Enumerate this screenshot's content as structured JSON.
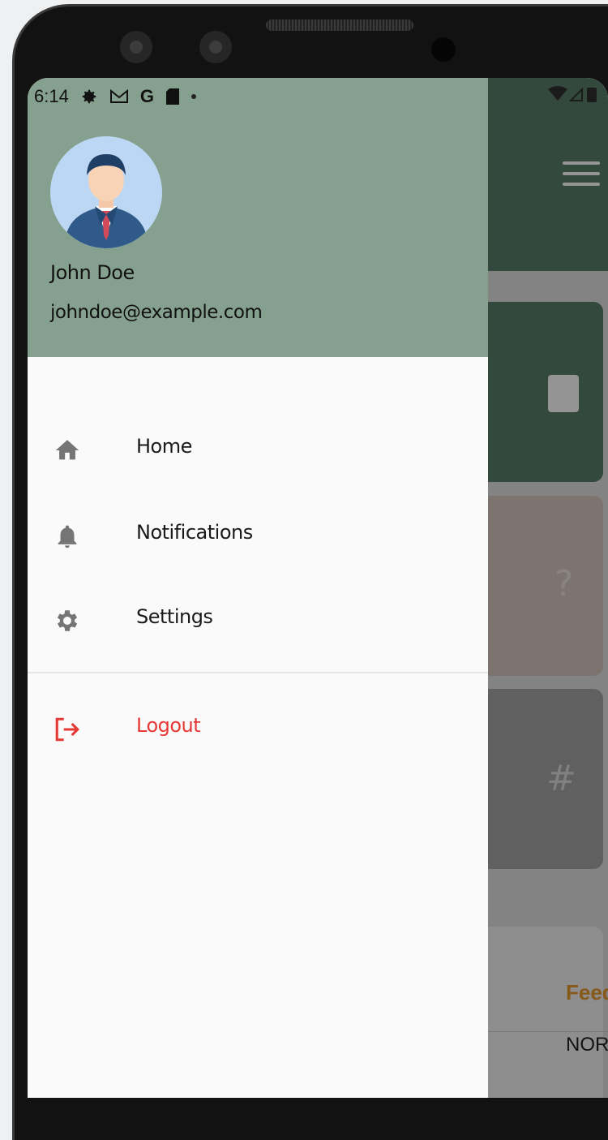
{
  "status_bar": {
    "time": "6:14",
    "icons": [
      "settings-icon",
      "gmail-icon",
      "google-icon",
      "sd-card-icon",
      "dot-icon"
    ],
    "google_glyph": "G",
    "right_icons": [
      "wifi-icon",
      "signal-icon",
      "battery-icon"
    ]
  },
  "drawer": {
    "user": {
      "name": "John Doe",
      "email": "johndoe@example.com"
    },
    "items": [
      {
        "label": "Home",
        "icon": "home-icon"
      },
      {
        "label": "Notifications",
        "icon": "bell-icon"
      },
      {
        "label": "Settings",
        "icon": "gear-icon"
      }
    ],
    "logout": {
      "label": "Logout",
      "icon": "logout-icon"
    }
  },
  "background_app": {
    "cards": [
      {
        "icon": "book-icon"
      },
      {
        "icon": "question-icon",
        "glyph": "?"
      },
      {
        "icon": "hash-icon",
        "glyph": "#"
      }
    ],
    "feed_label": "Feed",
    "nor_label": "NOR"
  },
  "colors": {
    "drawer_header": "#86a08f",
    "drawer_bg": "#fafafa",
    "logout": "#e53935",
    "icon_grey": "#757575",
    "app_primary": "#5b7f69"
  }
}
